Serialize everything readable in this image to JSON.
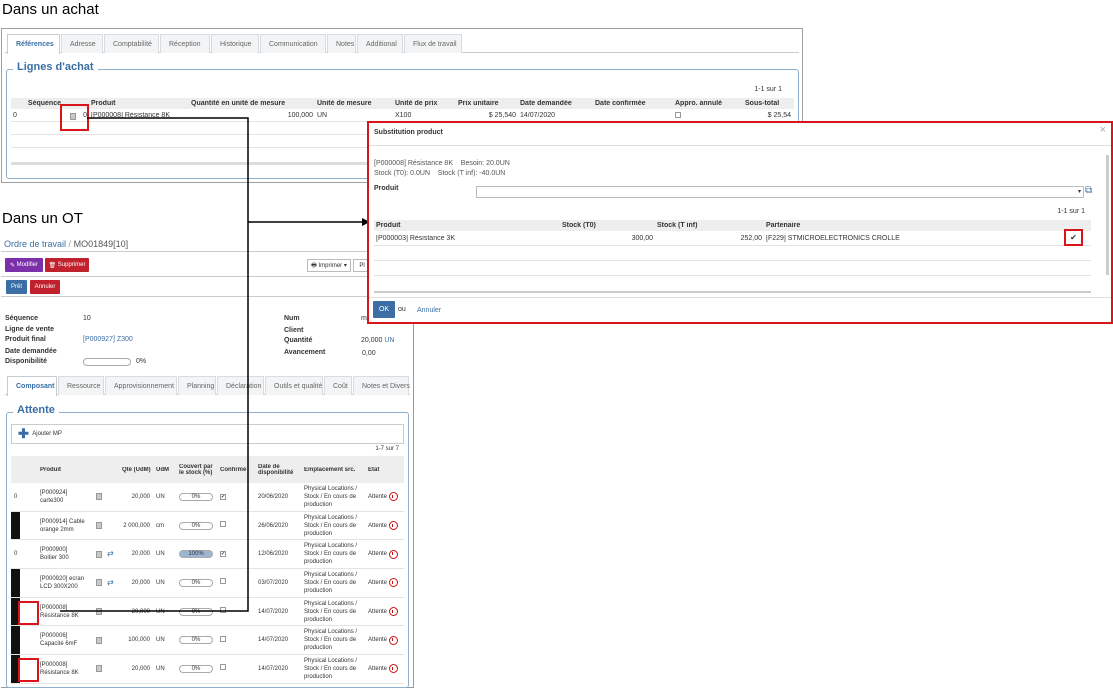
{
  "captions": {
    "top": "Dans un achat",
    "middle": "Dans un OT"
  },
  "purchase": {
    "tabs": [
      "Références",
      "Adresse",
      "Comptabilité",
      "Réception",
      "Historique",
      "Communication",
      "Notes",
      "Additional",
      "Flux de travail"
    ],
    "section_title": "Lignes d'achat",
    "pager": "1-1 sur 1",
    "columns": [
      "Séquence",
      "Produit",
      "Quantité en unité de mesure",
      "Unité de mesure",
      "Unité de prix",
      "Prix unitaire",
      "Date demandée",
      "Date confirmée",
      "Appro. annulé",
      "Sous-total"
    ],
    "row": {
      "sequence": "0",
      "seq2": "0",
      "product": "[P000008] Résistance 8K",
      "quantity": "100,000",
      "uom": "UN",
      "price_unit": "X100",
      "unit_price": "$ 25,540",
      "date": "14/07/2020",
      "subtotal": "$ 25,54"
    }
  },
  "dialog": {
    "title": "Substitution product",
    "close": "×",
    "info_line1": "[P000008] Résistance 8K    Besoin: 20.0UN",
    "info_line2": "Stock (T0): 0.0UN    Stock (T inf): -40.0UN",
    "product_label": "Produit",
    "product_value": "",
    "pager": "1-1 sur 1",
    "columns": [
      "Produit",
      "Stock (T0)",
      "Stock (T inf)",
      "Partenaire"
    ],
    "row": {
      "product": "[P000003] Résistance 3K",
      "stock_t0": "300,00",
      "stock_tinf": "252,00",
      "partner": "[F229] STMICROELECTRONICS CROLLE",
      "check": "✔"
    },
    "ok": "OK",
    "or": "ou",
    "cancel": "Annuler"
  },
  "wo": {
    "breadcrumb_root": "Ordre de travail",
    "breadcrumb_sep": "/",
    "breadcrumb_current": "MO01849[10]",
    "btn_edit": "Modifier",
    "btn_delete": "Supprimer",
    "btn_print": "Imprimer ▾",
    "btn_more": "Pl",
    "btn_ready": "Prêt",
    "btn_cancel": "Annuler",
    "fields": {
      "sequence_label": "Séquence",
      "sequence_value": "10",
      "sale_line_label": "Ligne de vente",
      "final_product_label": "Produit final",
      "final_product_value": "[P000927] Z300",
      "date_label": "Date demandée",
      "availability_label": "Disponibilité",
      "availability_value": "0%",
      "num_label": "Num",
      "num_value": "m",
      "client_label": "Client",
      "quantity_label": "Quantité",
      "quantity_value": "20,000",
      "quantity_uom": "UN",
      "progress_label": "Avancement",
      "progress_value": "0,00"
    },
    "tabs": [
      "Composant",
      "Ressource",
      "Approvisionnement",
      "Planning",
      "Déclaration",
      "Outils et qualité",
      "Coût",
      "Notes et Divers"
    ],
    "section_title": "Attente",
    "add_label": "Ajouter MP",
    "pager": "1-7 sur 7",
    "columns": [
      "Produit",
      "Qté (UdM)",
      "UdM",
      "Couvert par le stock (%)",
      "Confirmé",
      "Date de disponibilité",
      "Emplacement src.",
      "État"
    ],
    "rows": [
      {
        "seq": "0",
        "product_line1": "[P000924]",
        "product_line2": "carte300",
        "qty": "20,000",
        "uom": "UN",
        "cover": "0%",
        "confirmed": "✔",
        "date": "20/06/2020",
        "loc1": "Physical Locations /",
        "loc2": "Stock / En cours de",
        "loc3": "production",
        "state": "Attente"
      },
      {
        "seq": "",
        "product_line1": "[P000914] Cable",
        "product_line2": "orange 2mm",
        "qty": "2 000,000",
        "uom": "cm",
        "cover": "0%",
        "confirmed": "",
        "date": "26/06/2020",
        "loc1": "Physical Locations /",
        "loc2": "Stock / En cours de",
        "loc3": "production",
        "state": "Attente"
      },
      {
        "seq": "0",
        "product_line1": "[P000900]",
        "product_line2": "Boitier 300",
        "qty": "20,000",
        "uom": "UN",
        "cover": "100%",
        "confirmed": "✔",
        "date": "12/06/2020",
        "loc1": "Physical Locations /",
        "loc2": "Stock / En cours de",
        "loc3": "production",
        "state": "Attente"
      },
      {
        "seq": "",
        "product_line1": "[P000920] ecran",
        "product_line2": "LCD 300X200",
        "qty": "20,000",
        "uom": "UN",
        "cover": "0%",
        "confirmed": "",
        "date": "03/07/2020",
        "loc1": "Physical Locations /",
        "loc2": "Stock / En cours de",
        "loc3": "production",
        "state": "Attente"
      },
      {
        "seq": "",
        "product_line1": "[P000008]",
        "product_line2": "Résistance 8K",
        "qty": "20,000",
        "uom": "UN",
        "cover": "0%",
        "confirmed": "",
        "date": "14/07/2020",
        "loc1": "Physical Locations /",
        "loc2": "Stock / En cours de",
        "loc3": "production",
        "state": "Attente"
      },
      {
        "seq": "",
        "product_line1": "[P000006]",
        "product_line2": "Capacité 6mF",
        "qty": "100,000",
        "uom": "UN",
        "cover": "0%",
        "confirmed": "",
        "date": "14/07/2020",
        "loc1": "Physical Locations /",
        "loc2": "Stock / En cours de",
        "loc3": "production",
        "state": "Attente"
      },
      {
        "seq": "",
        "product_line1": "[P000008]",
        "product_line2": "Résistance 8K",
        "qty": "20,000",
        "uom": "UN",
        "cover": "0%",
        "confirmed": "",
        "date": "14/07/2020",
        "loc1": "Physical Locations /",
        "loc2": "Stock / En cours de",
        "loc3": "production",
        "state": "Attente"
      }
    ]
  },
  "colors": {
    "accent": "#3a6ea5",
    "highlight": "#d9151c",
    "edit_button": "#7b2fa8",
    "delete_button": "#c0212c"
  }
}
